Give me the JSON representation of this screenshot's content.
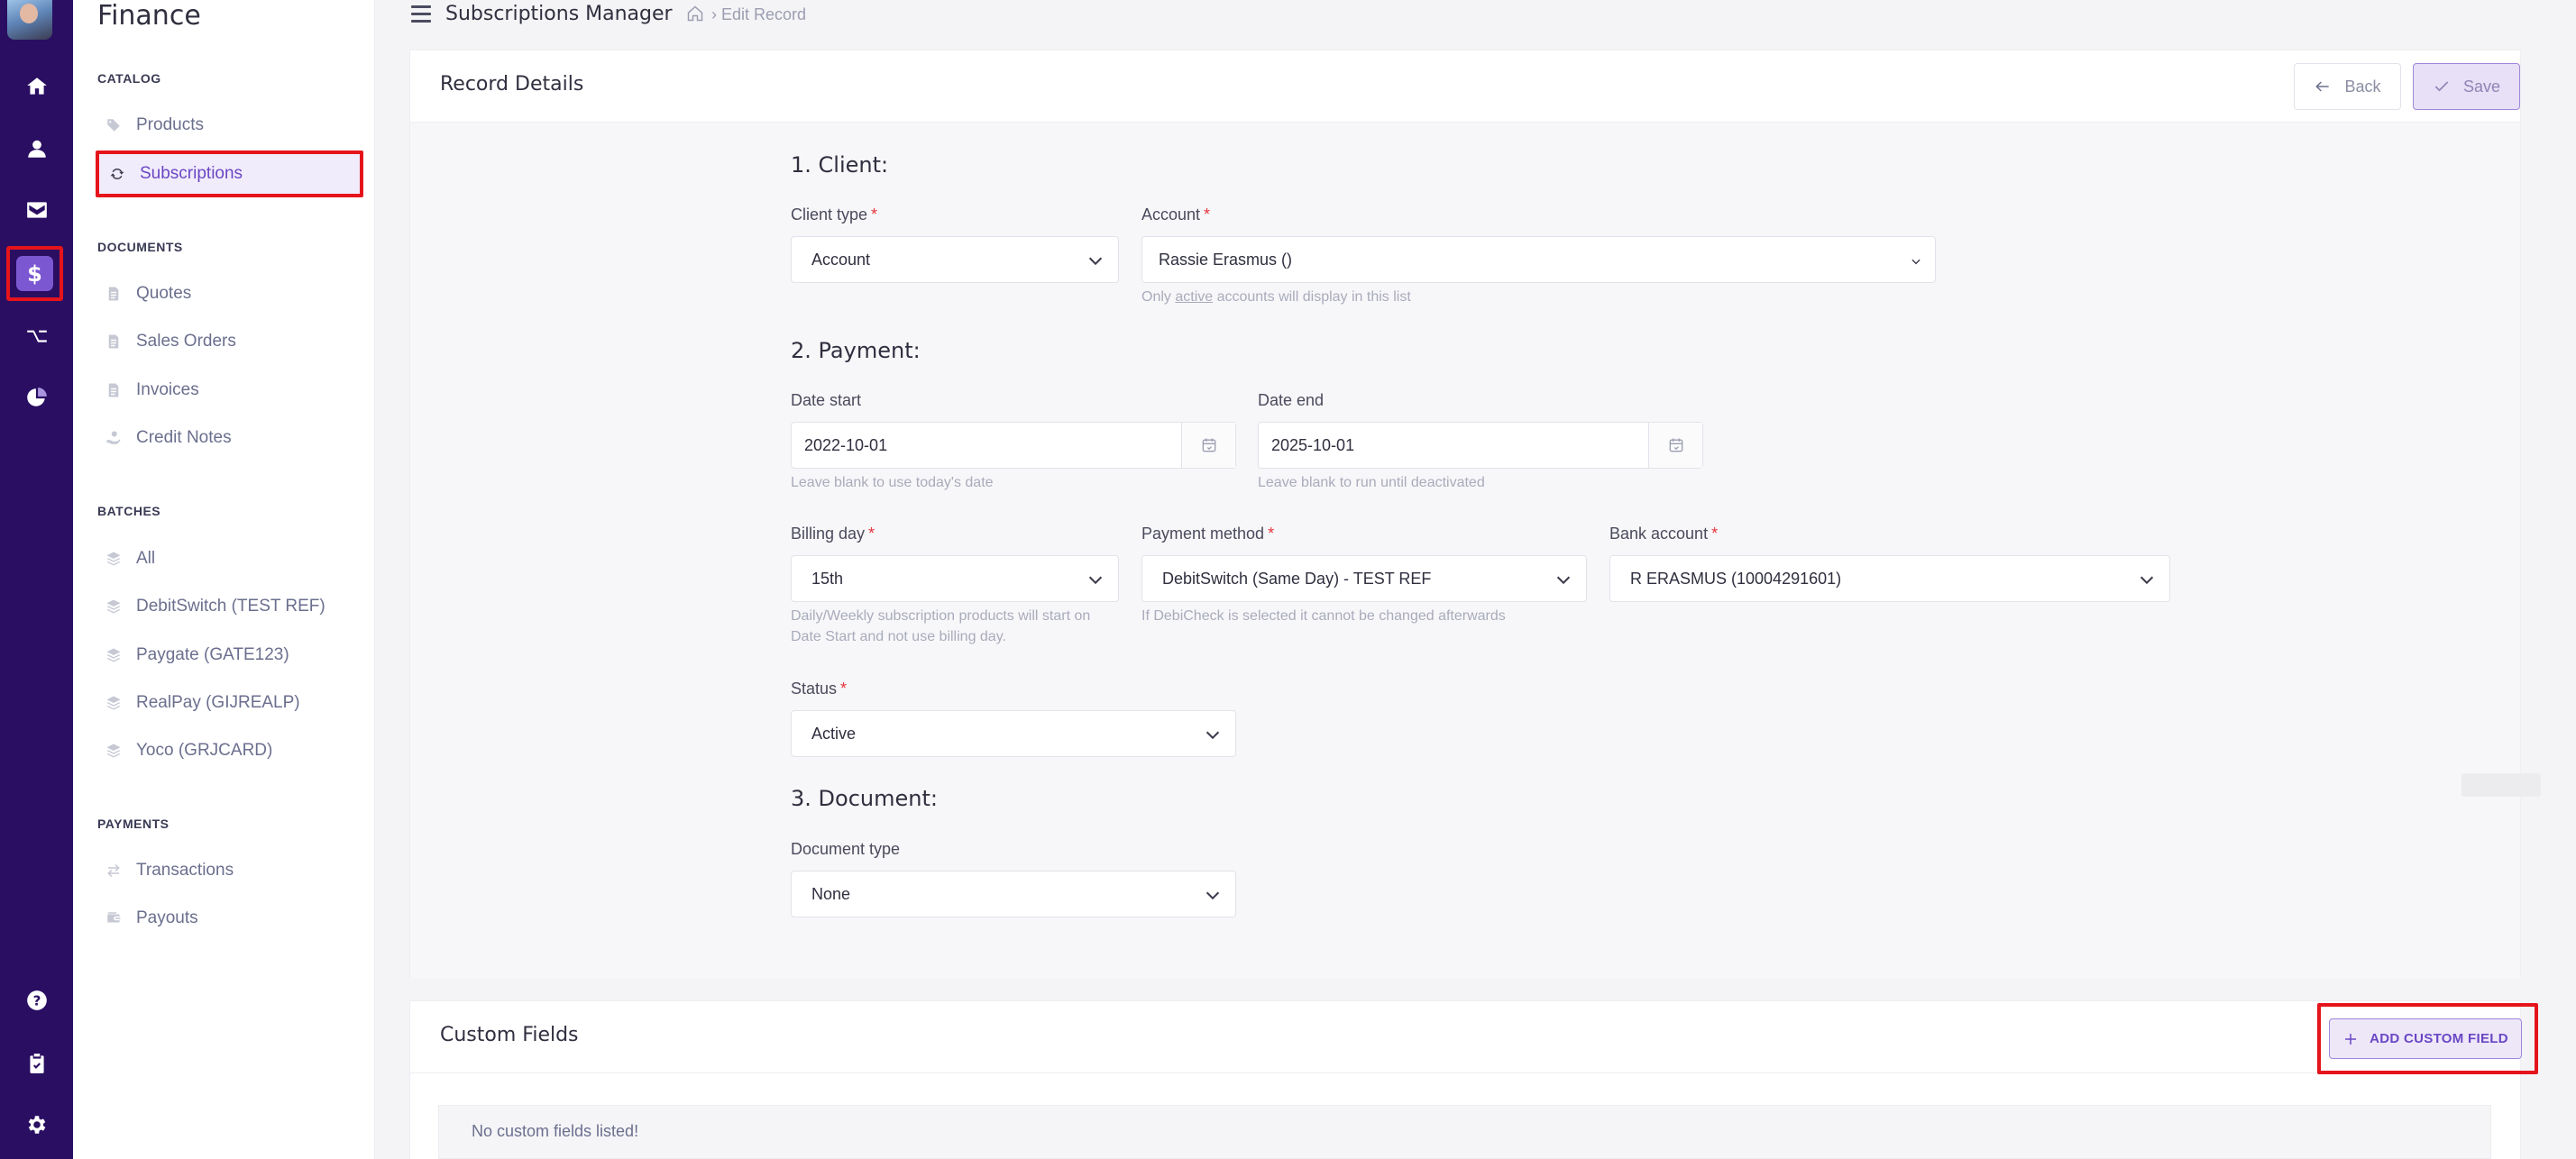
{
  "sidebar": {
    "title": "Finance",
    "sections": {
      "catalog": "CATALOG",
      "documents": "DOCUMENTS",
      "batches": "BATCHES",
      "payments": "PAYMENTS"
    },
    "catalog_items": [
      "Products",
      "Subscriptions"
    ],
    "document_items": [
      "Quotes",
      "Sales Orders",
      "Invoices",
      "Credit Notes"
    ],
    "batch_items": [
      "All",
      "DebitSwitch (TEST REF)",
      "Paygate (GATE123)",
      "RealPay (GIJREALP)",
      "Yoco (GRJCARD)"
    ],
    "payment_items": [
      "Transactions",
      "Payouts"
    ],
    "active_item": "Subscriptions"
  },
  "rail": {
    "icons": [
      "home-icon",
      "user-icon",
      "inbox-icon",
      "dollar-icon",
      "workflow-icon",
      "pie-chart-icon",
      "help-icon",
      "clipboard-icon",
      "settings-icon"
    ],
    "dollar_glyph": "$",
    "accent": "#7b57d1",
    "background": "#2a0e62"
  },
  "header": {
    "title": "Subscriptions Manager",
    "breadcrumb": "› Edit Record"
  },
  "record": {
    "title": "Record Details",
    "back_label": "Back",
    "save_label": "Save",
    "client": {
      "heading": "1. Client:",
      "client_type_label": "Client type",
      "client_type_value": "Account",
      "account_label": "Account",
      "account_value": "Rassie Erasmus ()",
      "account_hint_pre": "Only ",
      "account_hint_link": "active",
      "account_hint_post": " accounts will display in this list"
    },
    "payment": {
      "heading": "2. Payment:",
      "date_start_label": "Date start",
      "date_start_value": "2022-10-01",
      "date_start_hint": "Leave blank to use today's date",
      "date_end_label": "Date end",
      "date_end_value": "2025-10-01",
      "date_end_hint": "Leave blank to run until deactivated",
      "billing_day_label": "Billing day",
      "billing_day_value": "15th",
      "billing_day_hint_1": "Daily/Weekly subscription products will start on",
      "billing_day_hint_2": "Date Start and not use billing day.",
      "payment_method_label": "Payment method",
      "payment_method_value": "DebitSwitch (Same Day) - TEST REF",
      "payment_method_hint": "If DebiCheck is selected it cannot be changed afterwards",
      "bank_account_label": "Bank account",
      "bank_account_value": "R ERASMUS (10004291601)",
      "status_label": "Status",
      "status_value": "Active"
    },
    "document": {
      "heading": "3. Document:",
      "document_type_label": "Document type",
      "document_type_value": "None"
    },
    "required_mark": "*"
  },
  "custom_fields": {
    "title": "Custom Fields",
    "add_label": "ADD CUSTOM FIELD",
    "empty_text": "No custom fields listed!"
  },
  "colors": {
    "highlight": "#e5141b",
    "accent": "#6a46c4"
  }
}
